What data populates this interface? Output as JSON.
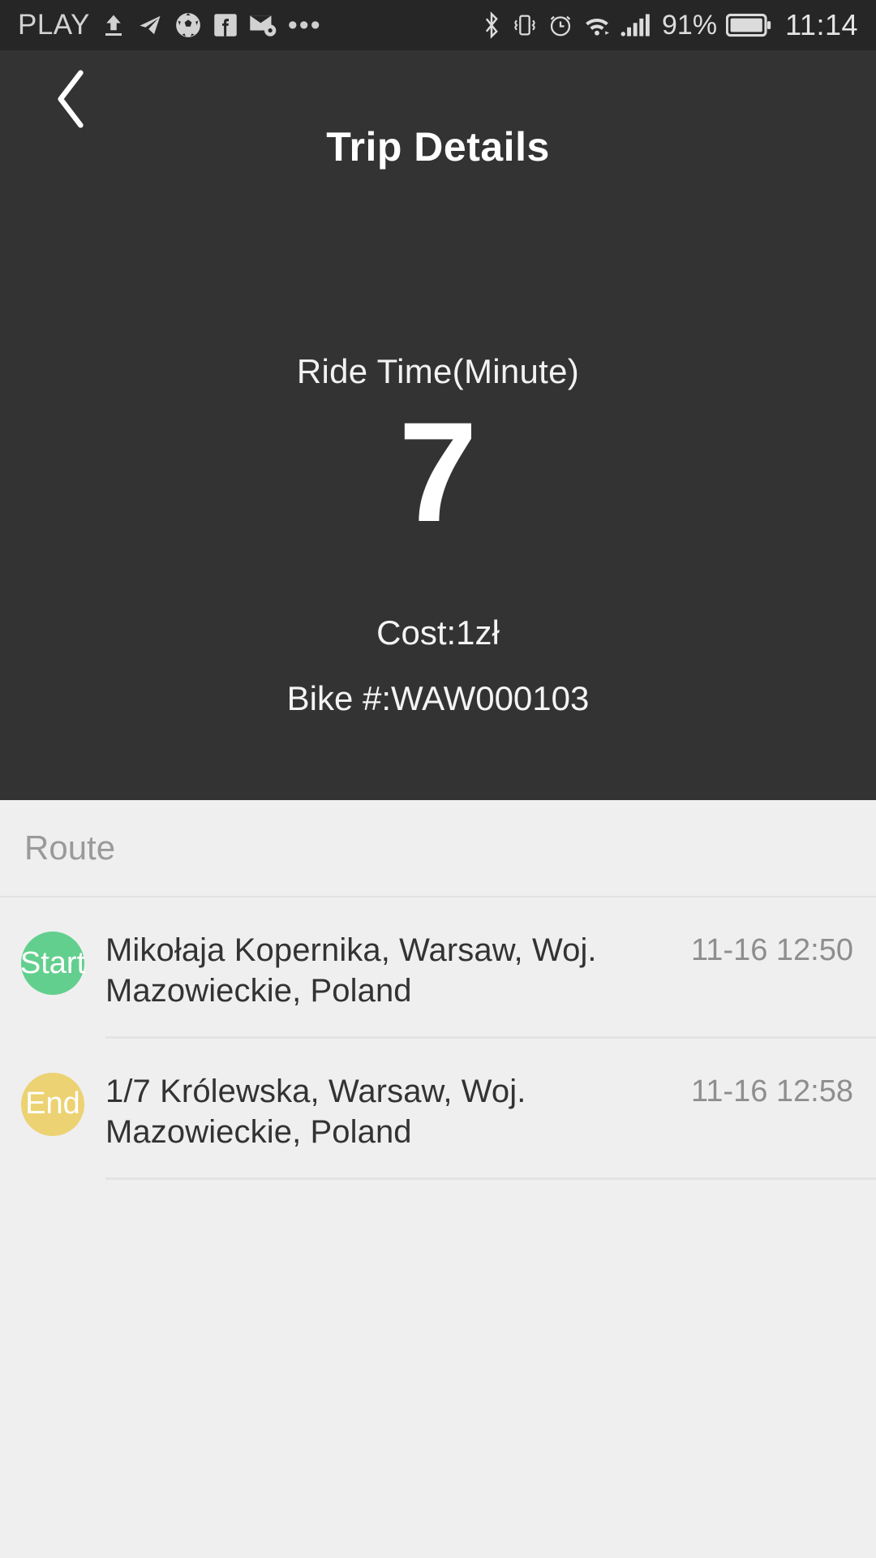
{
  "statusbar": {
    "carrier": "PLAY",
    "left_icons": [
      "upload-icon",
      "telegram-icon",
      "soccer-ball-icon",
      "facebook-icon",
      "mail-settings-icon",
      "more-icon"
    ],
    "right_icons": [
      "bluetooth-icon",
      "vibrate-icon",
      "alarm-icon",
      "wifi-icon",
      "signal-icon",
      "battery-icon"
    ],
    "battery_percent": "91%",
    "time": "11:14"
  },
  "header": {
    "title": "Trip Details",
    "back_icon": "chevron-left-icon"
  },
  "summary": {
    "ride_time_label": "Ride Time(Minute)",
    "ride_time_value": "7",
    "cost": "Cost:1zł",
    "bike": "Bike #:WAW000103"
  },
  "route": {
    "section_title": "Route",
    "stops": [
      {
        "badge": "Start",
        "badge_color": "#63cf8e",
        "address": "Mikołaja Kopernika, Warsaw, Woj. Mazowieckie, Poland",
        "time": "11-16 12:50"
      },
      {
        "badge": "End",
        "badge_color": "#ecd272",
        "address": "1/7 Królewska, Warsaw, Woj. Mazowieckie, Poland",
        "time": "11-16 12:58"
      }
    ]
  },
  "colors": {
    "dark_panel": "#333333",
    "statusbar": "#262626",
    "page_bg": "#efeff0",
    "muted_text": "#8e8e8e"
  }
}
